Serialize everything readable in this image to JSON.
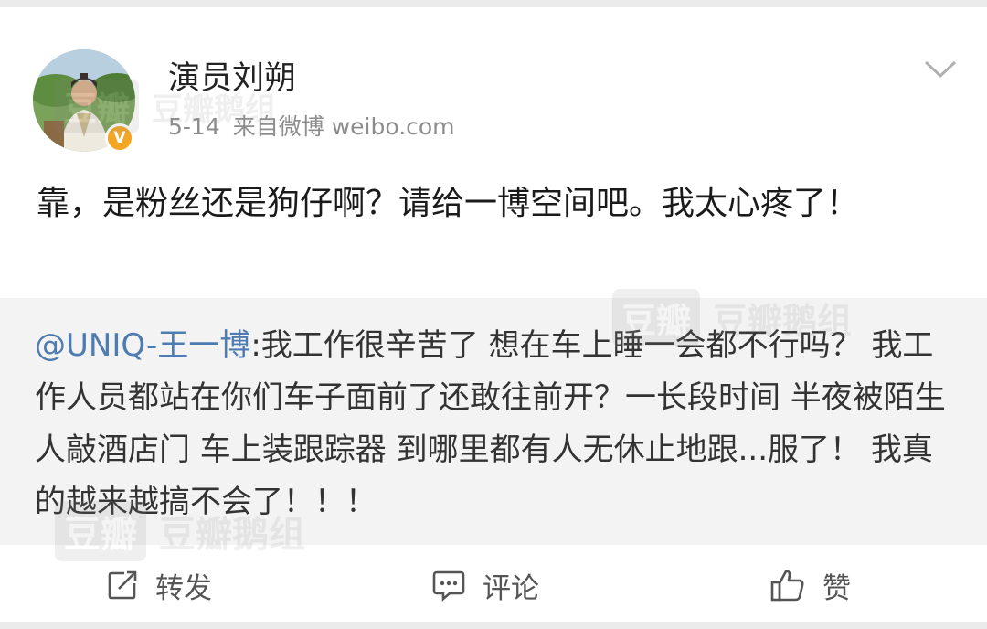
{
  "post": {
    "username": "演员刘朔",
    "date": "5-14",
    "source": "来自微博 weibo.com",
    "verified_badge": "V",
    "text": "靠，是粉丝还是狗仔啊？请给一博空间吧。我太心疼了！"
  },
  "retweet": {
    "mention": "@UNIQ-王一博",
    "text": ":我工作很辛苦了 想在车上睡一会都不行吗？ 我工作人员都站在你们车子面前了还敢往前开？一长段时间 半夜被陌生人敲酒店门 车上装跟踪器 到哪里都有人无休止地跟...服了！ 我真的越来越搞不会了！！！"
  },
  "actions": {
    "repost_label": "转发",
    "comment_label": "评论",
    "like_label": "赞"
  },
  "watermarks": {
    "box": "豆瓣",
    "text": "豆瓣鹅组"
  },
  "colors": {
    "mention": "#4e7cb1",
    "verified": "#f5a623",
    "retweet_bg": "#f3f3f3"
  },
  "icons": [
    "chevron-down-icon",
    "verified-icon",
    "repost-icon",
    "comment-icon",
    "like-icon"
  ]
}
